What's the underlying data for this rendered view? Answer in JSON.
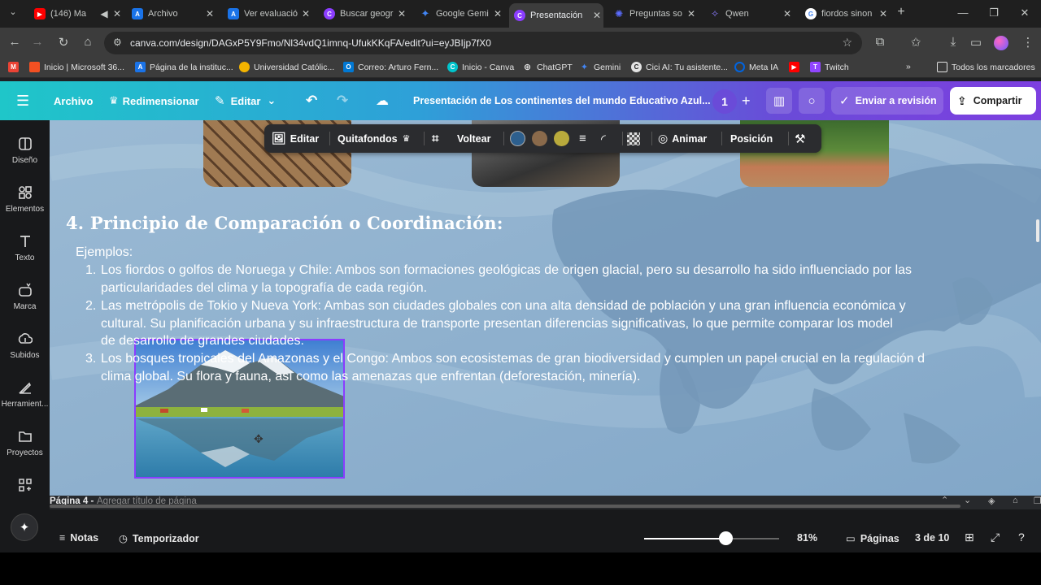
{
  "browser": {
    "tabs": [
      {
        "label": "(146) Ma",
        "icon": "youtube-icon",
        "color": "#ff0000"
      },
      {
        "label": "Archivo",
        "icon": "canva-a-icon",
        "color": "#1a73e8"
      },
      {
        "label": "Ver evaluació",
        "icon": "canva-a-icon",
        "color": "#1a73e8"
      },
      {
        "label": "Buscar geogr",
        "icon": "canva-c-icon",
        "color": "#8b3dff"
      },
      {
        "label": "Google Gemi",
        "icon": "gemini-icon",
        "color": "#4285f4"
      },
      {
        "label": "Presentación",
        "icon": "canva-c-icon",
        "color": "#8b3dff",
        "active": true
      },
      {
        "label": "Preguntas so",
        "icon": "claude-icon",
        "color": "#5b6cff"
      },
      {
        "label": "Qwen",
        "icon": "qwen-icon",
        "color": "#6b5bff"
      },
      {
        "label": "fiordos sinon",
        "icon": "google-icon",
        "color": "#ffffff"
      }
    ],
    "url": "canva.com/design/DAGxP5Y9Fmo/Nl34vdQ1imnq-UfukKKqFA/edit?ui=eyJBIjp7fX0",
    "bookmarks": [
      {
        "label": "Inicio | Microsoft 36...",
        "color": "#f25022"
      },
      {
        "label": "Página de la instituc...",
        "color": "#1a73e8"
      },
      {
        "label": "Universidad Católic...",
        "color": "#f4b400"
      },
      {
        "label": "Correo: Arturo Fern...",
        "color": "#0078d4"
      },
      {
        "label": "Inicio - Canva",
        "color": "#00c4cc"
      },
      {
        "label": "ChatGPT",
        "color": "#444444"
      },
      {
        "label": "Gemini",
        "color": "#4285f4"
      },
      {
        "label": "Cici AI: Tu asistente...",
        "color": "#222222"
      },
      {
        "label": "Meta IA",
        "color": "#0064e0"
      },
      {
        "label": "Twitch",
        "color": "#9146ff"
      }
    ],
    "all_bookmarks": "Todos los marcadores"
  },
  "canva_header": {
    "archivo": "Archivo",
    "redimensionar": "Redimensionar",
    "editar": "Editar",
    "doc_title": "Presentación de Los continentes del mundo Educativo Azul...",
    "collab_count": "1",
    "review": "Enviar a revisión",
    "share": "Compartir"
  },
  "sidebar": [
    {
      "label": "Diseño",
      "icon": "design-icon"
    },
    {
      "label": "Elementos",
      "icon": "elements-icon"
    },
    {
      "label": "Texto",
      "icon": "text-icon"
    },
    {
      "label": "Marca",
      "icon": "brand-icon"
    },
    {
      "label": "Subidos",
      "icon": "upload-icon"
    },
    {
      "label": "Herramient...",
      "icon": "tools-icon"
    },
    {
      "label": "Proyectos",
      "icon": "folder-icon"
    }
  ],
  "image_toolbar": {
    "edit": "Editar",
    "bg_remover": "Quitafondos",
    "flip": "Voltear",
    "colors": [
      "#2d5f8e",
      "#8a6a4b",
      "#b9aa3c"
    ],
    "animate": "Animar",
    "position": "Posición"
  },
  "slide": {
    "heading": "4. Principio de Comparación o Coordinación:",
    "intro": "Ejemplos:",
    "items": [
      {
        "num": "1.",
        "line1": "Los fiordos o golfos de Noruega y Chile: Ambos son formaciones geológicas de origen glacial, pero su desarrollo ha sido influenciado por las",
        "line2": "particularidades del clima y la topografía de cada región."
      },
      {
        "num": "2.",
        "line1": "Las metrópolis de Tokio y Nueva York: Ambas son ciudades globales con una alta densidad de población y una gran influencia económica y",
        "line2": "cultural. Su planificación urbana y su infraestructura de transporte presentan diferencias significativas, lo que permite comparar los model",
        "line3": "de desarrollo de grandes ciudades."
      },
      {
        "num": "3.",
        "line1": "Los bosques tropicales del Amazonas y el Congo: Ambos son ecosistemas de gran biodiversidad y cumplen un papel crucial en la regulación d",
        "line2": "clima global. Su flora y fauna, así como las amenazas que enfrentan (deforestación, minería)."
      }
    ]
  },
  "footer": {
    "page_label": "Página 4 -",
    "page_title_placeholder": "Agregar título de página",
    "notes": "Notas",
    "timer": "Temporizador",
    "zoom": "81%",
    "zoom_fraction": 0.6,
    "pages": "Páginas",
    "page_count": "3 de 10"
  }
}
